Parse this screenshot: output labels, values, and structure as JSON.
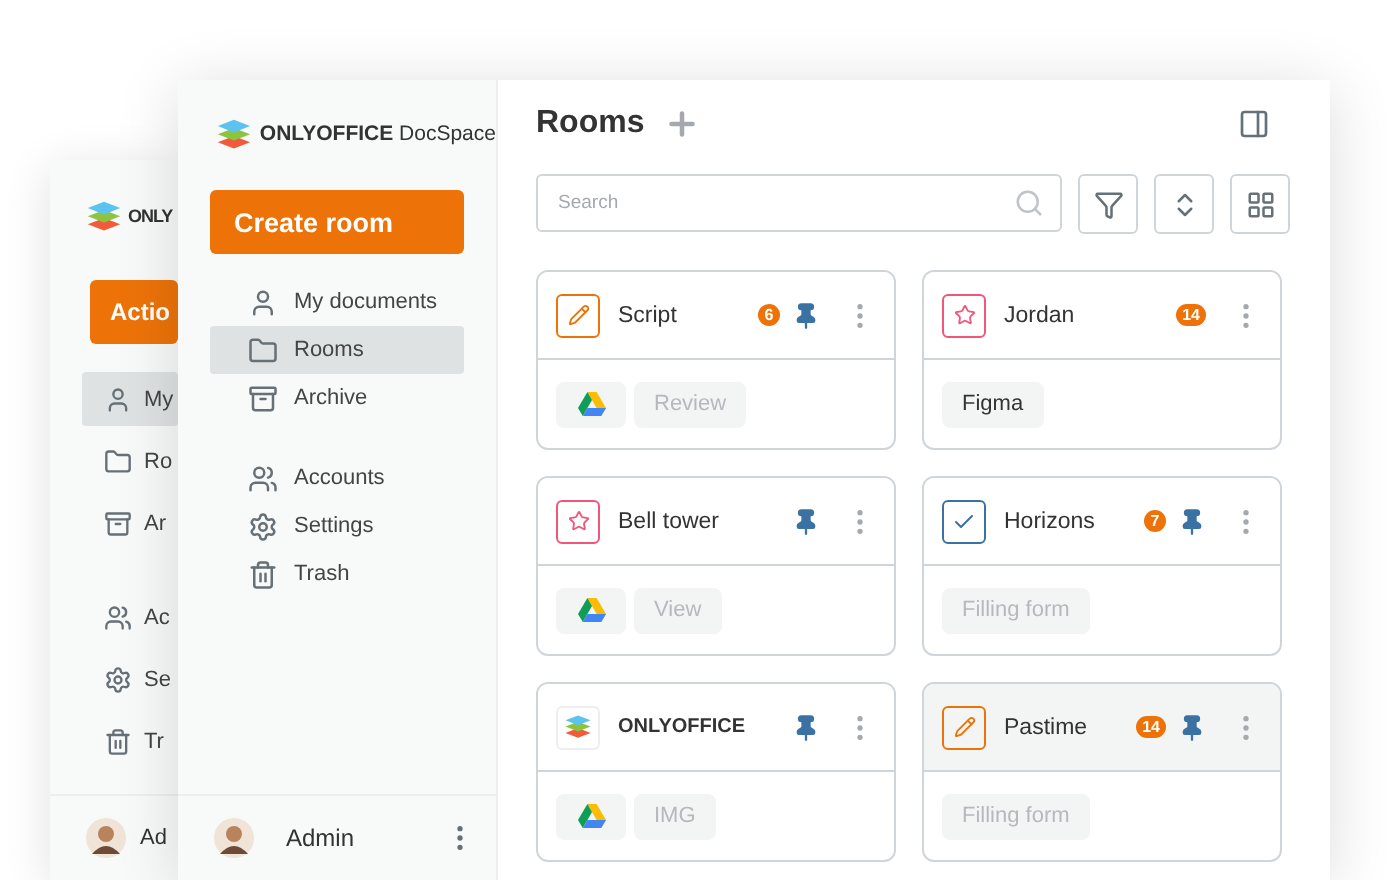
{
  "back_window": {
    "logo_text": "ONLY",
    "action_button": "Actio",
    "nav_groups": [
      [
        {
          "label": "My",
          "selected": true
        },
        {
          "label": "Ro",
          "selected": false
        },
        {
          "label": "Ar",
          "selected": false
        }
      ],
      [
        {
          "label": "Ac",
          "selected": false
        },
        {
          "label": "Se",
          "selected": false
        },
        {
          "label": "Tr",
          "selected": false
        }
      ]
    ],
    "user": "Ad"
  },
  "window": {
    "logo": "**ONLYOFFICE** DocSpace",
    "create_button": "Create room",
    "nav_groups": [
      [
        {
          "label": "My documents",
          "selected": false
        },
        {
          "label": "Rooms",
          "selected": true
        },
        {
          "label": "Archive",
          "selected": false
        }
      ],
      [
        {
          "label": "Accounts",
          "selected": false
        },
        {
          "label": "Settings",
          "selected": false
        },
        {
          "label": "Trash",
          "selected": false
        }
      ]
    ],
    "user": "Admin",
    "title": "Rooms",
    "search": {
      "placeholder": "Search"
    },
    "rooms": [
      {
        "name": "Script",
        "kind": "edit",
        "badge": "6",
        "pinned": true,
        "selected": false,
        "storage": true,
        "tags": [
          {
            "label": "Review",
            "muted": true
          }
        ]
      },
      {
        "name": "Jordan",
        "kind": "star",
        "badge": "14",
        "pinned": false,
        "selected": false,
        "storage": false,
        "tags": [
          {
            "label": "Figma",
            "muted": false
          }
        ]
      },
      {
        "name": "Bell tower",
        "kind": "star",
        "pinned": true,
        "selected": false,
        "storage": true,
        "tags": [
          {
            "label": "View",
            "muted": true
          }
        ]
      },
      {
        "name": "Horizons",
        "kind": "check",
        "badge": "7",
        "pinned": true,
        "selected": false,
        "storage": false,
        "tags": [
          {
            "label": "Filling form",
            "muted": true
          }
        ]
      },
      {
        "name": "ONLYOFFICE",
        "kind": "logo",
        "pinned": true,
        "selected": false,
        "storage": true,
        "tags": [
          {
            "label": "IMG",
            "muted": true
          }
        ]
      },
      {
        "name": "Pastime",
        "kind": "edit",
        "badge": "14",
        "pinned": true,
        "selected": true,
        "storage": false,
        "tags": [
          {
            "label": "Filling form",
            "muted": true
          }
        ]
      }
    ]
  }
}
